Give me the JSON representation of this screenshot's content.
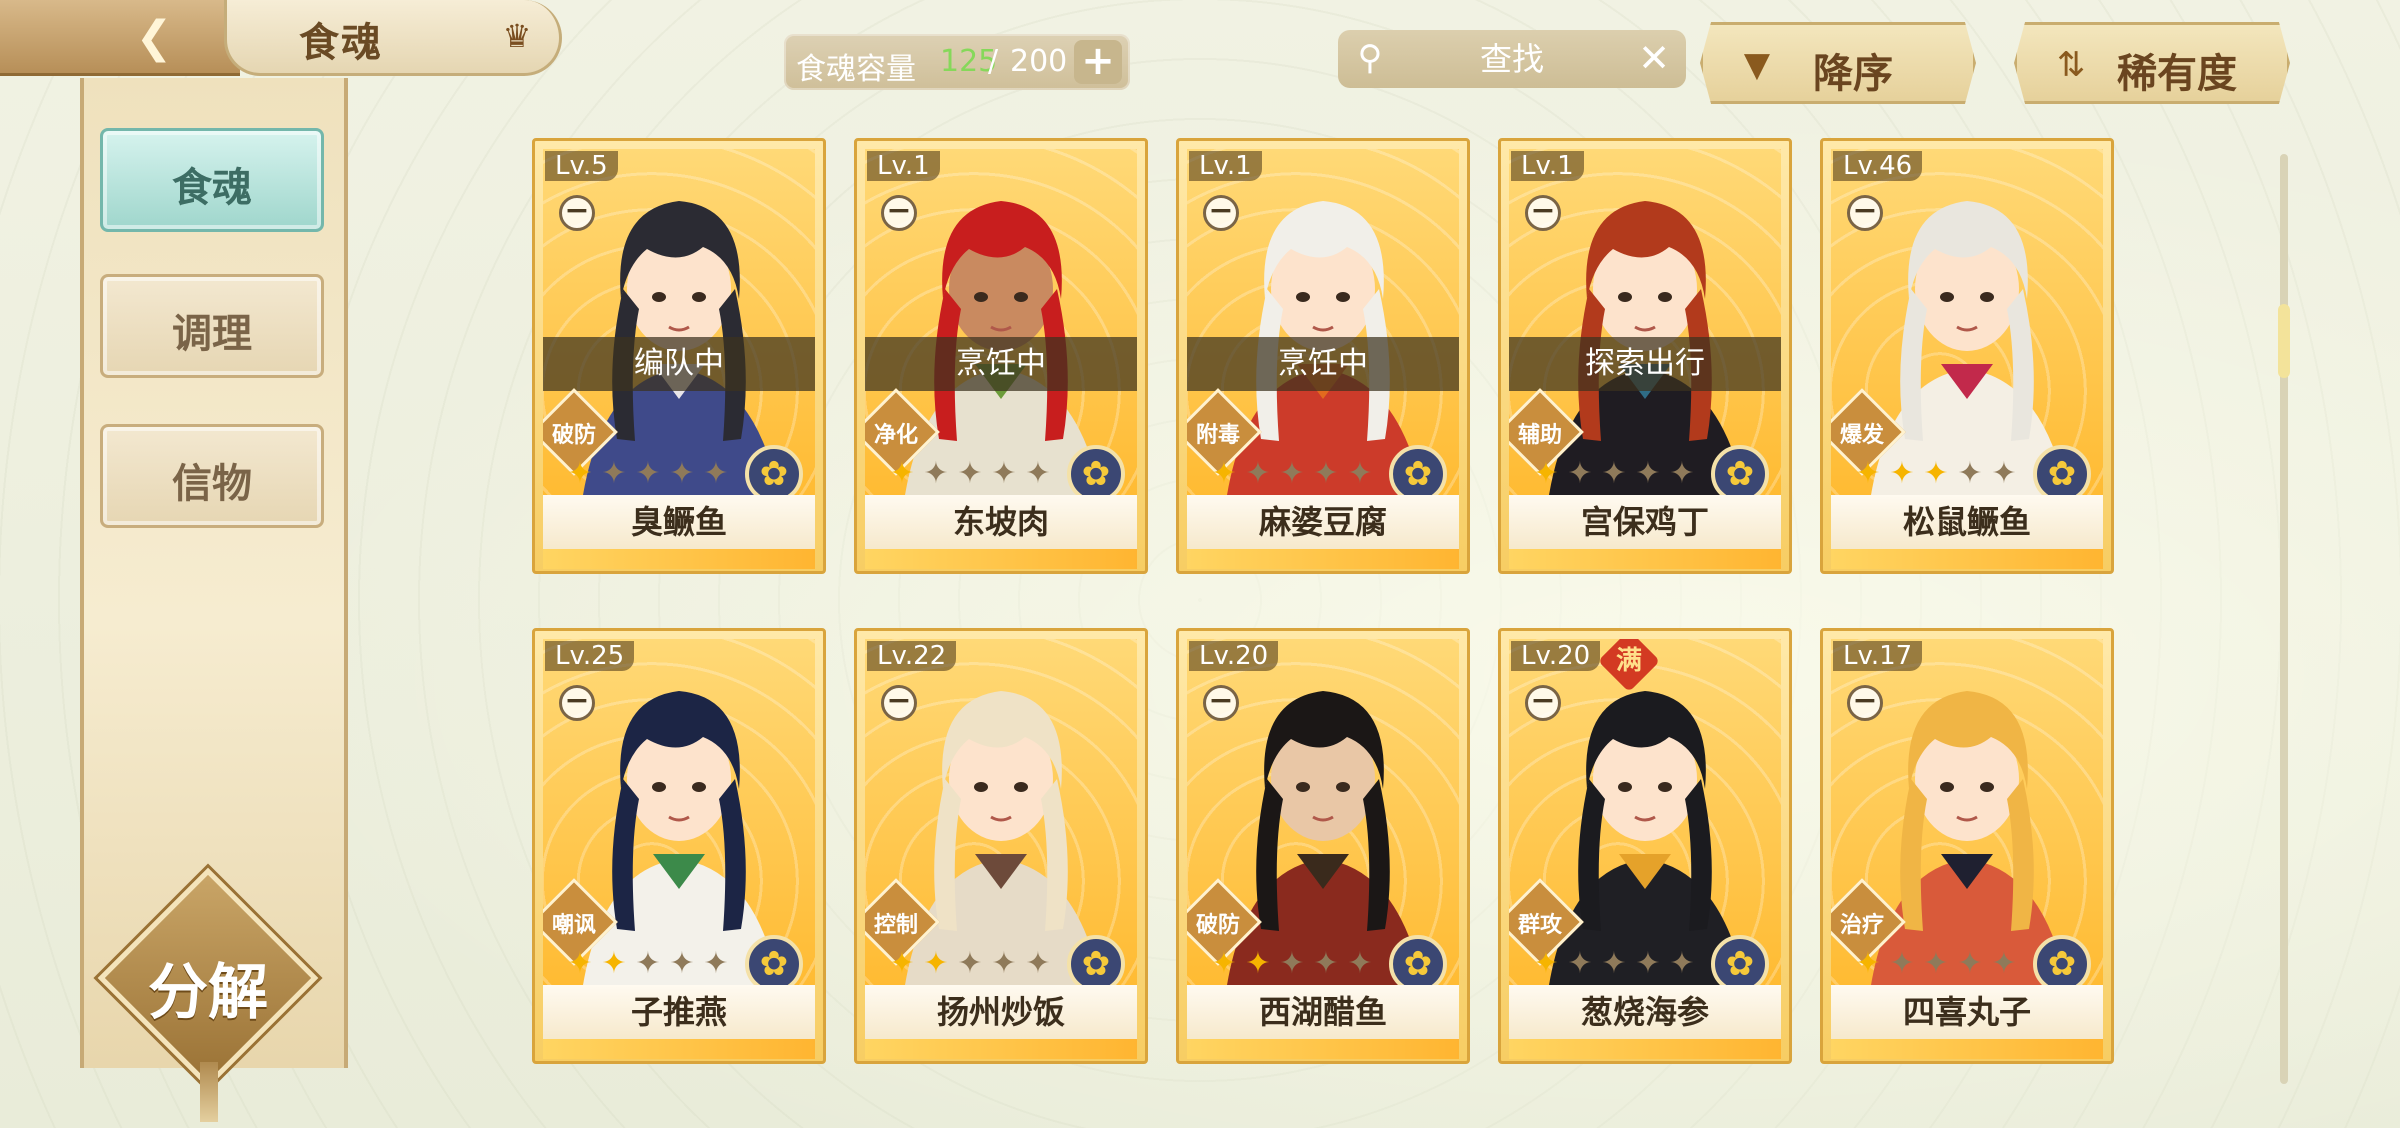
{
  "header": {
    "back_icon": "back-arrow-icon",
    "title": "食魂",
    "crown_icon": "crown-icon",
    "capacity": {
      "label": "食魂容量",
      "current": "125",
      "separator": "/",
      "max": "200",
      "add_label": "+"
    },
    "search": {
      "placeholder": "查找",
      "clear_label": "✕"
    },
    "sort_desc": {
      "label": "降序",
      "icon": "triangle-down-icon"
    },
    "sort_rarity": {
      "label": "稀有度",
      "icon": "swap-icon"
    }
  },
  "sidebar": {
    "tabs": [
      {
        "label": "食魂",
        "active": true
      },
      {
        "label": "调理",
        "active": false
      },
      {
        "label": "信物",
        "active": false
      }
    ],
    "decompose_label": "分解"
  },
  "cards": [
    {
      "level": "Lv.5",
      "name": "臭鳜鱼",
      "status": "编队中",
      "role": "破防",
      "stars_on": 1,
      "hair": "#2b2b33",
      "skin": "#fde3cc",
      "cloth": "#3f4a8a",
      "accent": "#e9e6ea"
    },
    {
      "level": "Lv.1",
      "name": "东坡肉",
      "status": "烹饪中",
      "role": "净化",
      "stars_on": 1,
      "hair": "#c81e1e",
      "skin": "#c98a60",
      "cloth": "#e7e1cf",
      "accent": "#6c9c3a"
    },
    {
      "level": "Lv.1",
      "name": "麻婆豆腐",
      "status": "烹饪中",
      "role": "附毒",
      "stars_on": 1,
      "hair": "#f1efe9",
      "skin": "#fde3cc",
      "cloth": "#cc3b2a",
      "accent": "#e26a1e"
    },
    {
      "level": "Lv.1",
      "name": "宫保鸡丁",
      "status": "探索出行",
      "role": "辅助",
      "stars_on": 1,
      "hair": "#b23a1c",
      "skin": "#fde3cc",
      "cloth": "#1f1c22",
      "accent": "#2f6c86"
    },
    {
      "level": "Lv.46",
      "name": "松鼠鳜鱼",
      "status": "",
      "role": "爆发",
      "stars_on": 3,
      "hair": "#e9e6de",
      "skin": "#fde3cc",
      "cloth": "#f4efe4",
      "accent": "#c2294b"
    },
    {
      "level": "Lv.25",
      "name": "子推燕",
      "status": "",
      "role": "嘲讽",
      "stars_on": 2,
      "hair": "#1c2545",
      "skin": "#fde3cc",
      "cloth": "#f3f1ea",
      "accent": "#3c8a4a"
    },
    {
      "level": "Lv.22",
      "name": "扬州炒饭",
      "status": "",
      "role": "控制",
      "stars_on": 2,
      "hair": "#efe2c6",
      "skin": "#fde3cc",
      "cloth": "#e6dbc7",
      "accent": "#6d4a3a"
    },
    {
      "level": "Lv.20",
      "name": "西湖醋鱼",
      "status": "",
      "role": "破防",
      "stars_on": 2,
      "hair": "#1b1716",
      "skin": "#e9c7a6",
      "cloth": "#8a2a1e",
      "accent": "#3a2a1c"
    },
    {
      "level": "Lv.20",
      "name": "葱烧海参",
      "status": "",
      "role": "群攻",
      "stars_on": 1,
      "hair": "#1b1b1f",
      "skin": "#fde3cc",
      "cloth": "#1f1f24",
      "accent": "#e5a22a",
      "full_badge": "满"
    },
    {
      "level": "Lv.17",
      "name": "四喜丸子",
      "status": "",
      "role": "治疗",
      "stars_on": 1,
      "hair": "#f0b545",
      "skin": "#fde3cc",
      "cloth": "#d95a3a",
      "accent": "#1f2030"
    }
  ],
  "icons": {
    "star_on": "crescent-gold-icon",
    "star_off": "crescent-gray-icon",
    "element": "flower-element-icon",
    "minus": "minus-icon"
  },
  "colors": {
    "card_gold": "#f7cd63",
    "active_tab": "#9fd6cc",
    "capacity_current": "#86d85a"
  }
}
